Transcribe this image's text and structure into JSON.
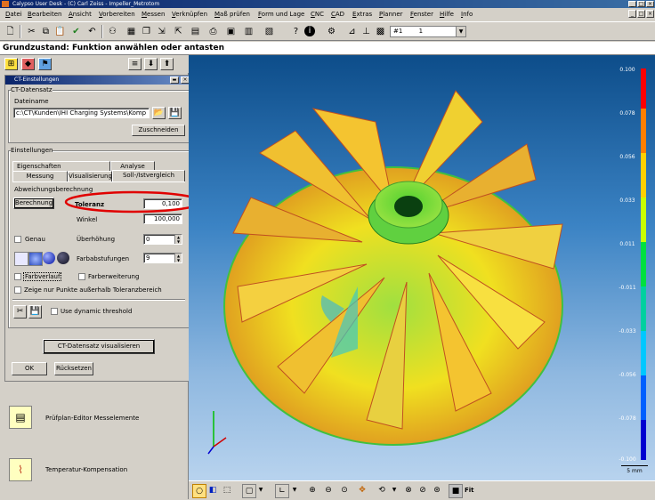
{
  "window": {
    "title": "Calypso User Desk - (C) Carl Zeiss - Impeller_Metrotom",
    "controls": [
      "_",
      "□",
      "×"
    ],
    "mdi_controls": [
      "_",
      "□",
      "×"
    ]
  },
  "menu": {
    "items": [
      "Datei",
      "Bearbeiten",
      "Ansicht",
      "Vorbereiten",
      "Messen",
      "Verknüpfen",
      "Maß prüfen",
      "Form und Lage",
      "CNC",
      "CAD",
      "Extras",
      "Planner",
      "Fenster",
      "Hilfe",
      "Info"
    ]
  },
  "toolbar": {
    "icons": [
      "new-icon",
      "cut-icon",
      "copy-icon",
      "paste-icon",
      "check-icon",
      "undo-icon",
      "binoculars-icon",
      "view-icon",
      "copy2-icon",
      "export-icon",
      "print-icon",
      "print2-icon",
      "print3-icon",
      "help-icon",
      "info-icon",
      "robot-icon",
      "meter-icon",
      "grid-icon"
    ],
    "combo_label": "#1",
    "combo_value": "1"
  },
  "status": {
    "text": "Grundzustand: Funktion anwählen oder antasten"
  },
  "dialog": {
    "title": "CT-Einstellungen",
    "ct_group_label": "CT-Datensatz",
    "dateiname_label": "Dateiname",
    "file_path": "c:\\CT\\Kunden\\IHI Charging Systems\\Komp",
    "zuschneiden_label": "Zuschneiden",
    "einstellungen_label": "Einstellungen",
    "tabs_row1": [
      "Eigenschaften",
      "Analyse"
    ],
    "tabs_row2": [
      "Messung",
      "Visualisierung",
      "Soll-/Istvergleich"
    ],
    "abweichung_label": "Abweichungsberechnung",
    "berechnung_label": "Berechnung",
    "toleranz_label": "Toleranz",
    "toleranz_value": "0,100",
    "winkel_label": "Winkel",
    "winkel_value": "100,000",
    "genau_label": "Genau",
    "ueberhoehung_label": "Überhöhung",
    "ueberhoehung_value": "0",
    "farbabstufungen_label": "Farbabstufungen",
    "farbabstufungen_value": "9",
    "farbverlauf_label": "Farbverlauf",
    "farberweiterung_label": "Farberweiterung",
    "zeige_label": "Zeige nur Punkte außerhalb Toleranzbereich",
    "dynamic_label": "Use dynamic threshold",
    "visualisieren_label": "CT-Datensatz visualisieren",
    "ok_label": "OK",
    "ruecksetzen_label": "Rücksetzen"
  },
  "bottom_items": [
    {
      "label": "Prüfplan-Editor Messelemente",
      "icon": "plan-editor-icon"
    },
    {
      "label": "Temperatur-Kompensation",
      "icon": "temperature-icon"
    }
  ],
  "scale": {
    "ticks": [
      "0.100",
      "0.078",
      "0.056",
      "0.033",
      "0.011",
      "-0.011",
      "-0.033",
      "-0.056",
      "-0.078",
      "-0.100"
    ],
    "unit": "5 mm",
    "colors": [
      "#ff0000",
      "#ff7f00",
      "#ffd000",
      "#ffff00",
      "#7fff00",
      "#00e050",
      "#00d0c0",
      "#00a0ff",
      "#0040ff",
      "#0000d0"
    ]
  },
  "viewport_toolbar": {
    "fit_label": "Fit"
  },
  "colors": {
    "titlebar": "#0a246a",
    "highlight_ellipse": "#e00000",
    "viewport_top": "#0d4d8a",
    "viewport_bottom": "#b8d3ee"
  }
}
